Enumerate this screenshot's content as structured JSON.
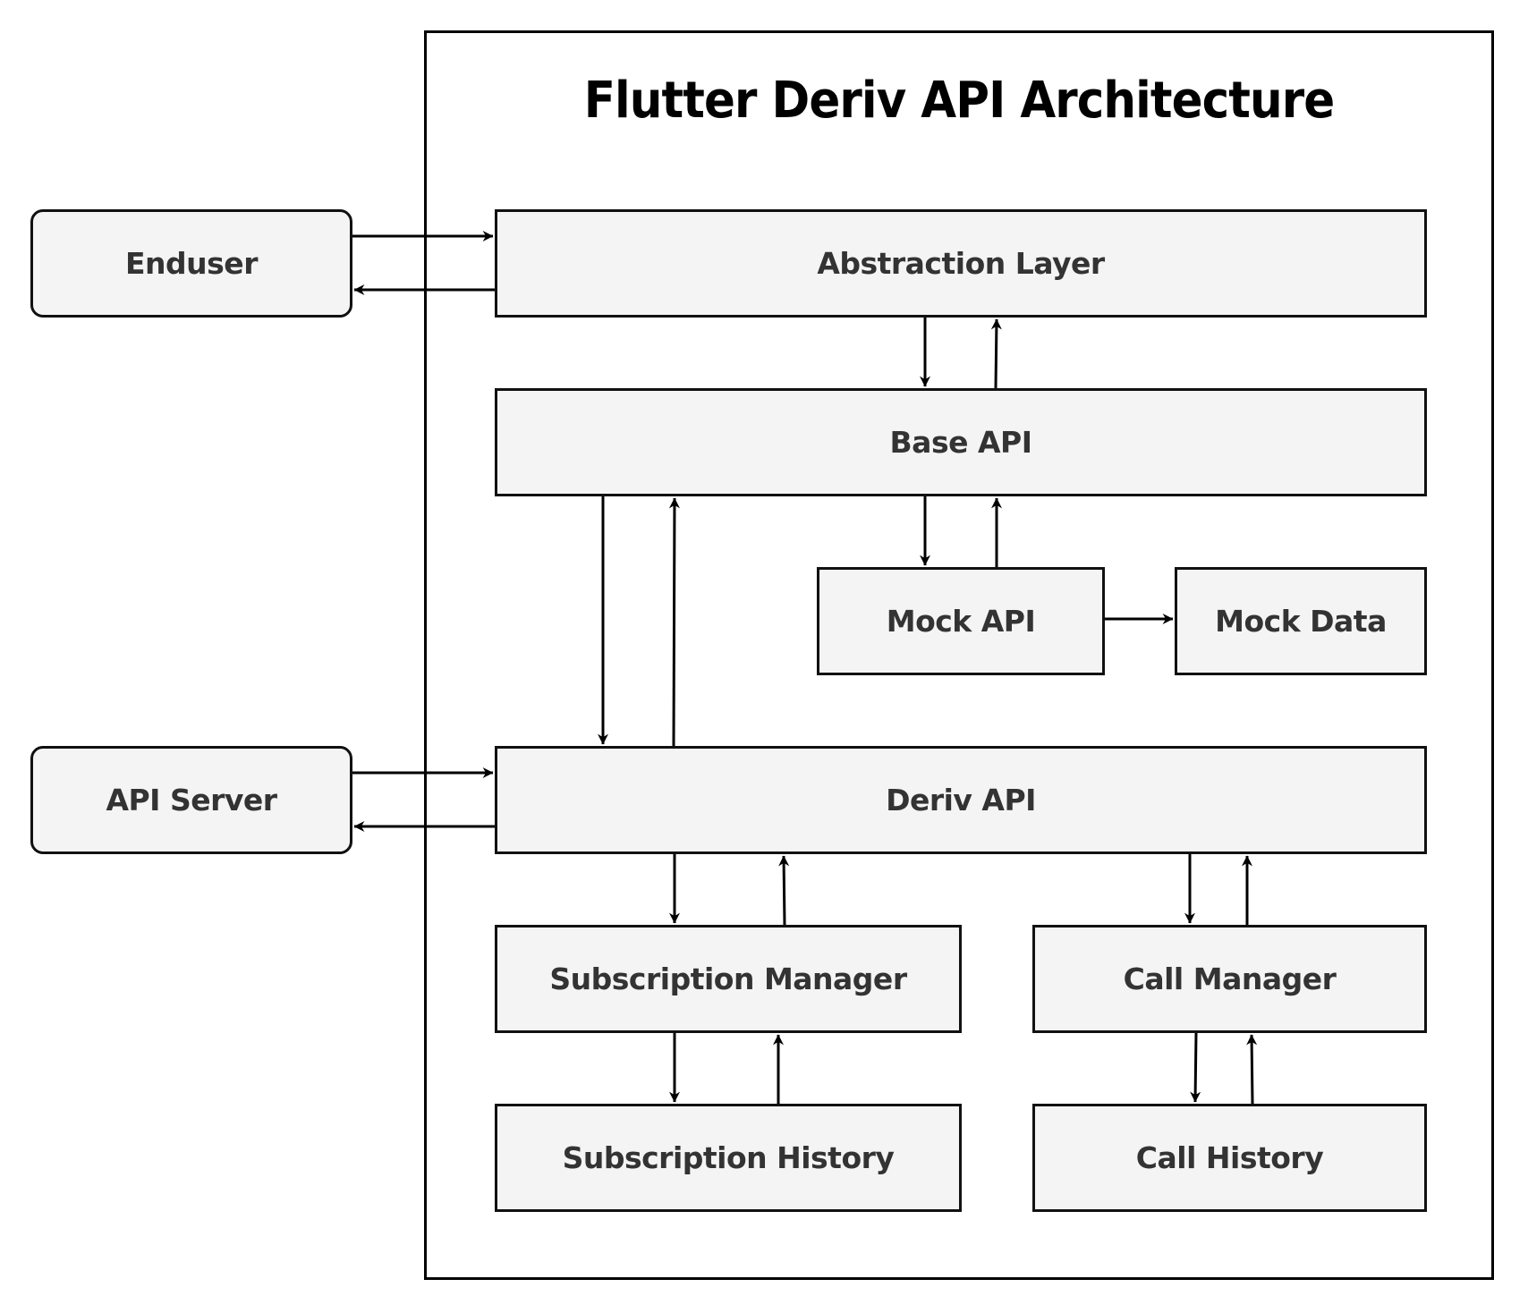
{
  "title": "Flutter Deriv API Architecture",
  "external": {
    "enduser": "Enduser",
    "api_server": "API Server"
  },
  "nodes": {
    "abstraction_layer": "Abstraction Layer",
    "base_api": "Base API",
    "mock_api": "Mock API",
    "mock_data": "Mock Data",
    "deriv_api": "Deriv API",
    "subscription_manager": "Subscription Manager",
    "call_manager": "Call Manager",
    "subscription_history": "Subscription History",
    "call_history": "Call History"
  },
  "edges": [
    {
      "from": "Enduser",
      "to": "Abstraction Layer"
    },
    {
      "from": "Abstraction Layer",
      "to": "Enduser"
    },
    {
      "from": "Abstraction Layer",
      "to": "Base API"
    },
    {
      "from": "Base API",
      "to": "Abstraction Layer"
    },
    {
      "from": "Base API",
      "to": "Mock API"
    },
    {
      "from": "Mock API",
      "to": "Base API"
    },
    {
      "from": "Mock API",
      "to": "Mock Data"
    },
    {
      "from": "Base API",
      "to": "Deriv API"
    },
    {
      "from": "Deriv API",
      "to": "Base API"
    },
    {
      "from": "API Server",
      "to": "Deriv API"
    },
    {
      "from": "Deriv API",
      "to": "API Server"
    },
    {
      "from": "Deriv API",
      "to": "Subscription Manager"
    },
    {
      "from": "Subscription Manager",
      "to": "Deriv API"
    },
    {
      "from": "Deriv API",
      "to": "Call Manager"
    },
    {
      "from": "Call Manager",
      "to": "Deriv API"
    },
    {
      "from": "Subscription Manager",
      "to": "Subscription History"
    },
    {
      "from": "Subscription History",
      "to": "Subscription Manager"
    },
    {
      "from": "Call Manager",
      "to": "Call History"
    },
    {
      "from": "Call History",
      "to": "Call Manager"
    }
  ]
}
